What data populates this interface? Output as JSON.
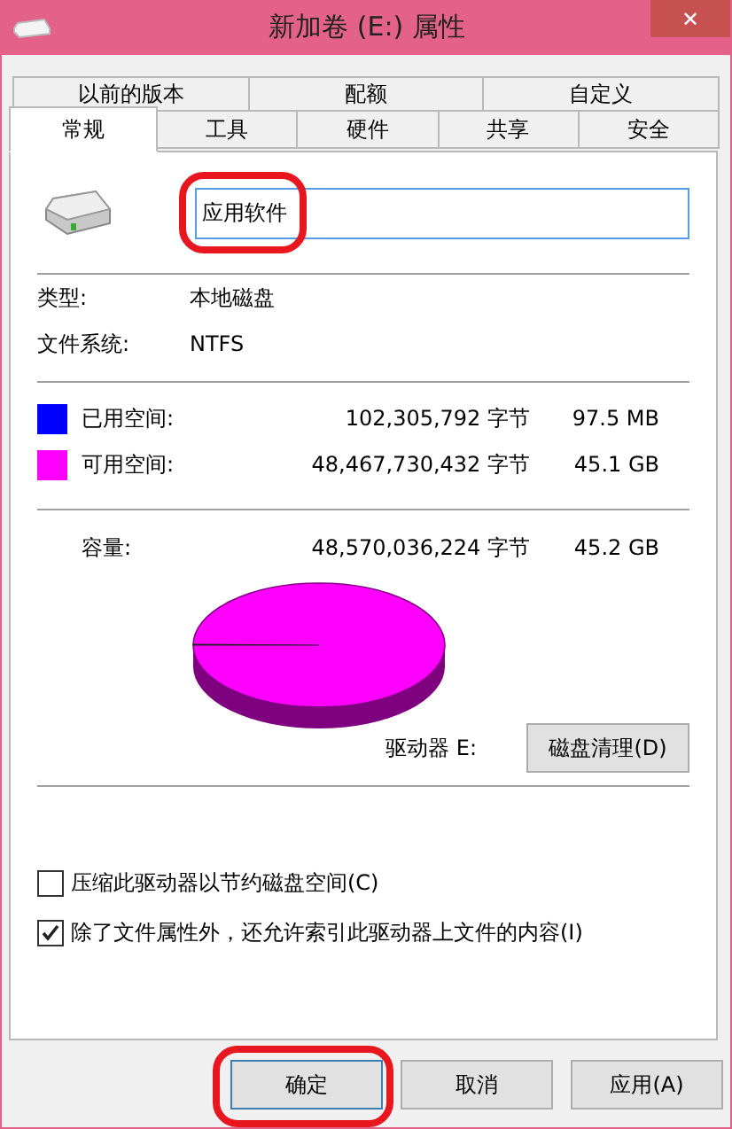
{
  "window": {
    "title": "新加卷 (E:) 属性",
    "close": "✕"
  },
  "tabs_back": [
    {
      "label": "以前的版本",
      "selected": false
    },
    {
      "label": "配额",
      "selected": false
    },
    {
      "label": "自定义",
      "selected": false
    }
  ],
  "tabs_front": [
    {
      "label": "常规",
      "selected": true
    },
    {
      "label": "工具",
      "selected": false
    },
    {
      "label": "硬件",
      "selected": false
    },
    {
      "label": "共享",
      "selected": false
    },
    {
      "label": "安全",
      "selected": false
    }
  ],
  "name_field": {
    "value": "应用软件",
    "annotated": true
  },
  "info": [
    {
      "label": "类型:",
      "value": "本地磁盘"
    },
    {
      "label": "文件系统:",
      "value": "NTFS"
    }
  ],
  "space": [
    {
      "label": "已用空间:",
      "bytes": "102,305,792 字节",
      "size": "97.5 MB",
      "color": "#0000ff"
    },
    {
      "label": "可用空间:",
      "bytes": "48,467,730,432 字节",
      "size": "45.1 GB",
      "color": "#ff00ff"
    }
  ],
  "capacity": {
    "label": "容量:",
    "bytes": "48,570,036,224 字节",
    "size": "45.2 GB"
  },
  "drive_label": "驱动器 E:",
  "cleanup_button": "磁盘清理(D)",
  "options": [
    {
      "label": "压缩此驱动器以节约磁盘空间(C)",
      "checked": false
    },
    {
      "label": "除了文件属性外，还允许索引此驱动器上文件的内容(I)",
      "checked": true
    }
  ],
  "buttons": [
    {
      "label": "确定",
      "annotated": true
    },
    {
      "label": "取消",
      "annotated": false
    },
    {
      "label": "应用(A)",
      "annotated": false
    }
  ]
}
